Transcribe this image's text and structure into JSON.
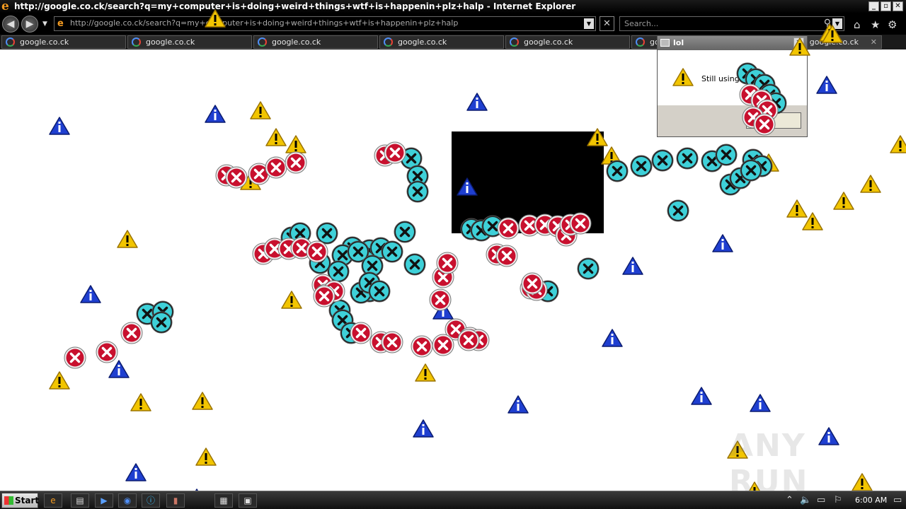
{
  "window": {
    "title": "http://google.co.ck/search?q=my+computer+is+doing+weird+things+wtf+is+happenin+plz+halp - Internet Explorer",
    "minimize": "_",
    "maximize": "▫",
    "close": "✕"
  },
  "address_bar": {
    "url": "http://google.co.ck/search?q=my+computer+is+doing+weird+things+wtf+is+happenin+plz+halp",
    "dropdown": "▼"
  },
  "search": {
    "placeholder": "Search...",
    "dropdown": "▼"
  },
  "tabs": [
    {
      "label": "google.co.ck"
    },
    {
      "label": "google.co.ck"
    },
    {
      "label": "google.co.ck"
    },
    {
      "label": "google.co.ck"
    },
    {
      "label": "google.co.ck"
    },
    {
      "label": "go"
    },
    {
      "label": "or google.co.ck",
      "close": "✕"
    }
  ],
  "dialog": {
    "title": "lol",
    "message": "Still using",
    "close": "✕"
  },
  "watermark": "ANY RUN",
  "taskbar": {
    "start_label": "Start",
    "clock": "6:00 AM"
  },
  "icons": {
    "warning": "warning-icon",
    "info": "info-icon",
    "error": "error-icon",
    "cyan_error": "cyan-error-icon"
  },
  "colors": {
    "warning": "#f2c500",
    "info": "#1f3fd0",
    "error": "#c8102e",
    "cyan_error": "#3ed0d8"
  }
}
